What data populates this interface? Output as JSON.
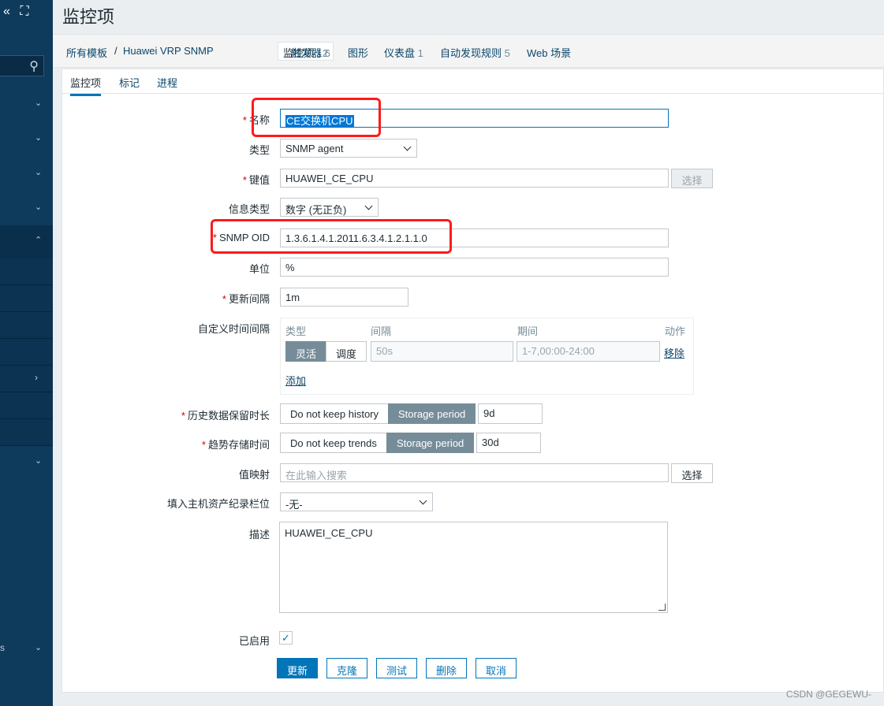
{
  "page": {
    "title": "监控项"
  },
  "sidebar": {
    "collapse_icon": "«",
    "expand_icon": "⛶",
    "search_icon": "search-icon",
    "bottom_label": "s"
  },
  "breadcrumbs": {
    "all_templates": "所有模板",
    "separator": "/",
    "template": "Huawei VRP SNMP",
    "items": {
      "label": "监控项",
      "count": "12"
    },
    "triggers": {
      "label": "触发器",
      "count": "6"
    },
    "graphs": {
      "label": "图形"
    },
    "dashboards": {
      "label": "仪表盘",
      "count": "1"
    },
    "discovery": {
      "label": "自动发现规则",
      "count": "5"
    },
    "web": {
      "label": "Web 场景"
    }
  },
  "tabs": {
    "item": "监控项",
    "tags": "标记",
    "process": "进程"
  },
  "form": {
    "name": {
      "label": "名称",
      "value": "CE交换机CPU"
    },
    "type": {
      "label": "类型",
      "value": "SNMP agent"
    },
    "key": {
      "label": "键值",
      "value": "HUAWEI_CE_CPU",
      "button": "选择"
    },
    "info_type": {
      "label": "信息类型",
      "value": "数字 (无正负)"
    },
    "snmp_oid": {
      "label": "SNMP OID",
      "value": "1.3.6.1.4.1.2011.6.3.4.1.2.1.1.0"
    },
    "units": {
      "label": "单位",
      "value": "%"
    },
    "interval": {
      "label": "更新间隔",
      "value": "1m"
    },
    "custom_intervals": {
      "label": "自定义时间间隔",
      "col_type": "类型",
      "col_interval": "间隔",
      "col_period": "期间",
      "col_action": "动作",
      "flexible": "灵活",
      "scheduling": "调度",
      "interval_placeholder": "50s",
      "period_placeholder": "1-7,00:00-24:00",
      "remove": "移除",
      "add": "添加"
    },
    "history": {
      "label": "历史数据保留时长",
      "opt_no": "Do not keep history",
      "opt_storage": "Storage period",
      "value": "9d"
    },
    "trends": {
      "label": "趋势存储时间",
      "opt_no": "Do not keep trends",
      "opt_storage": "Storage period",
      "value": "30d"
    },
    "value_map": {
      "label": "值映射",
      "placeholder": "在此输入搜索",
      "button": "选择"
    },
    "inventory": {
      "label": "填入主机资产纪录栏位",
      "value": "-无-"
    },
    "description": {
      "label": "描述",
      "value": "HUAWEI_CE_CPU"
    },
    "enabled": {
      "label": "已启用",
      "check": "✓"
    }
  },
  "buttons": {
    "update": "更新",
    "clone": "克隆",
    "test": "测试",
    "delete": "删除",
    "cancel": "取消"
  },
  "watermark": "CSDN @GEGEWU-",
  "colors": {
    "accent": "#0275b8",
    "sidebar": "#0e3a5c",
    "highlight": "#ff1a1a",
    "segment_active": "#768d99"
  }
}
